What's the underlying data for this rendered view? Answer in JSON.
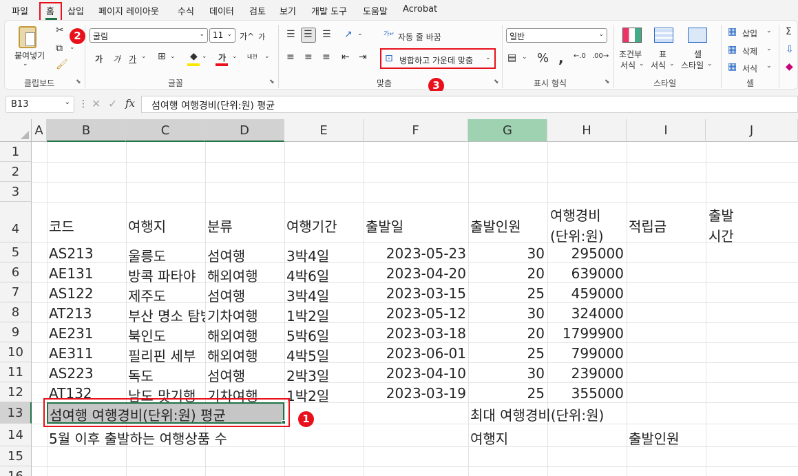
{
  "menu": [
    "파일",
    "홈",
    "삽입",
    "페이지 레이아웃",
    "수식",
    "데이터",
    "검토",
    "보기",
    "개발 도구",
    "도움말",
    "Acrobat"
  ],
  "ribbon": {
    "clipboard": {
      "paste": "붙여넣기",
      "label": "클립보드"
    },
    "font": {
      "name": "굴림",
      "size": "11",
      "label": "글꼴",
      "grow": "가^",
      "shrink": "가",
      "bold": "가",
      "italic": "가",
      "underline": "가",
      "ko": "내천"
    },
    "align": {
      "wrap": "자동 줄 바꿈",
      "merge": "병합하고 가운데 맞춤",
      "label": "맞춤"
    },
    "number": {
      "format": "일반",
      "label": "표시 형식",
      "percent": "%",
      "comma": ","
    },
    "styles": {
      "cond1": "조건부",
      "cond2": "서식",
      "table1": "표",
      "table2": "서식",
      "cell1": "셀",
      "cell2": "스타일",
      "label": "스타일"
    },
    "cells": {
      "insert": "삽입",
      "delete": "삭제",
      "format": "서식",
      "label": "셀"
    }
  },
  "namebox": "B13",
  "formula": "섬여행 여행경비(단위:원) 평균",
  "columns": [
    "A",
    "B",
    "C",
    "D",
    "E",
    "F",
    "G",
    "H",
    "I",
    "J"
  ],
  "rows": [
    "1",
    "2",
    "3",
    "4",
    "5",
    "6",
    "7",
    "8",
    "9",
    "10",
    "11",
    "12",
    "13",
    "14",
    "15",
    "16"
  ],
  "headers": {
    "code": "코드",
    "dest": "여행지",
    "cat": "분류",
    "period": "여행기간",
    "date": "출발일",
    "people": "출발인원",
    "cost1": "여행경비",
    "cost2": "(단위:원)",
    "points": "적립금",
    "time1": "출발",
    "time2": "시간"
  },
  "data": [
    [
      "AS213",
      "울릉도",
      "섬여행",
      "3박4일",
      "2023-05-23",
      "30",
      "295000"
    ],
    [
      "AE131",
      "방콕 파타야",
      "해외여행",
      "4박6일",
      "2023-04-20",
      "20",
      "639000"
    ],
    [
      "AS122",
      "제주도",
      "섬여행",
      "3박4일",
      "2023-03-15",
      "25",
      "459000"
    ],
    [
      "AT213",
      "부산 명소 탐방",
      "기차여행",
      "1박2일",
      "2023-05-12",
      "30",
      "324000"
    ],
    [
      "AE231",
      "북인도",
      "해외여행",
      "5박6일",
      "2023-03-18",
      "20",
      "1799900"
    ],
    [
      "AE311",
      "필리핀 세부",
      "해외여행",
      "4박5일",
      "2023-06-01",
      "25",
      "799000"
    ],
    [
      "AS223",
      "독도",
      "섬여행",
      "2박3일",
      "2023-04-10",
      "30",
      "239000"
    ],
    [
      "AT132",
      "남도 맛기행",
      "기차여행",
      "1박2일",
      "2023-03-19",
      "25",
      "355000"
    ]
  ],
  "row13": {
    "b": "섬여행 여행경비(단위:원) 평균",
    "g": "최대 여행경비(단위:원)"
  },
  "row14": {
    "b": "5월 이후 출발하는 여행상품 수",
    "g": "여행지",
    "i": "출발인원"
  },
  "badges": {
    "one": "1",
    "two": "2",
    "three": "3"
  },
  "colors": {
    "accent": "#217346",
    "red": "#e8101b",
    "selectedHeader": "#9ed2b1"
  }
}
